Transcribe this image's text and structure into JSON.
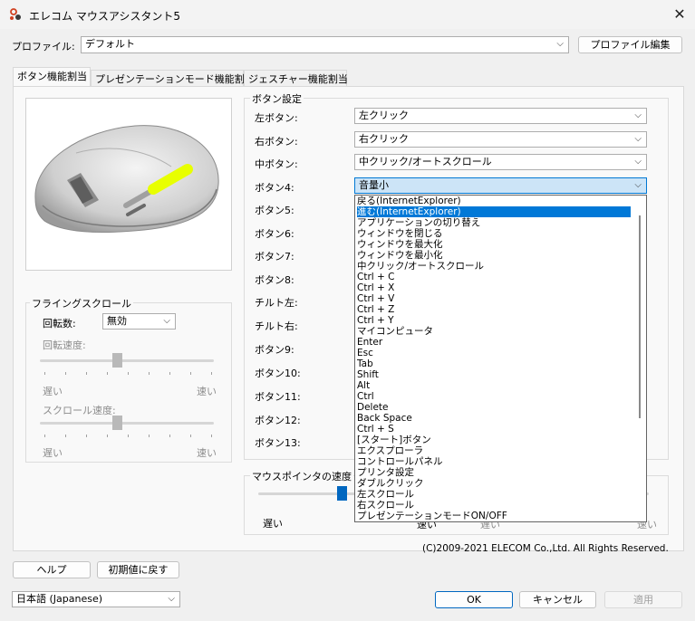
{
  "window": {
    "title": "エレコム マウスアシスタント5",
    "close_glyph": "✕"
  },
  "profile": {
    "label": "プロファイル:",
    "value": "デフォルト",
    "edit_button": "プロファイル編集"
  },
  "tabs": [
    {
      "label": "ボタン機能割当",
      "active": true
    },
    {
      "label": "プレゼンテーションモード機能割当",
      "active": false
    },
    {
      "label": "ジェスチャー機能割当",
      "active": false
    }
  ],
  "button_settings": {
    "title": "ボタン設定",
    "rows": [
      {
        "label": "左ボタン:",
        "value": "左クリック"
      },
      {
        "label": "右ボタン:",
        "value": "右クリック"
      },
      {
        "label": "中ボタン:",
        "value": "中クリック/オートスクロール"
      },
      {
        "label": "ボタン4:",
        "value": "音量小"
      },
      {
        "label": "ボタン5:"
      },
      {
        "label": "ボタン6:"
      },
      {
        "label": "ボタン7:"
      },
      {
        "label": "ボタン8:"
      },
      {
        "label": "チルト左:"
      },
      {
        "label": "チルト右:"
      },
      {
        "label": "ボタン9:"
      },
      {
        "label": "ボタン10:"
      },
      {
        "label": "ボタン11:"
      },
      {
        "label": "ボタン12:"
      },
      {
        "label": "ボタン13:"
      }
    ]
  },
  "dropdown_options": [
    "戻る(InternetExplorer)",
    "進む(InternetExplorer)",
    "アプリケーションの切り替え",
    "ウィンドウを閉じる",
    "ウィンドウを最大化",
    "ウィンドウを最小化",
    "中クリック/オートスクロール",
    "Ctrl + C",
    "Ctrl + X",
    "Ctrl + V",
    "Ctrl + Z",
    "Ctrl + Y",
    "マイコンピュータ",
    "Enter",
    "Esc",
    "Tab",
    "Shift",
    "Alt",
    "Ctrl",
    "Delete",
    "Back Space",
    "Ctrl + S",
    "[スタート]ボタン",
    "エクスプローラ",
    "コントロールパネル",
    "プリンタ設定",
    "ダブルクリック",
    "左スクロール",
    "右スクロール",
    "プレゼンテーションモードON/OFF"
  ],
  "dropdown_highlighted_index": 1,
  "flying_scroll": {
    "title": "フライングスクロール",
    "rotation_label": "回転数:",
    "rotation_value": "無効",
    "rotation_speed_label": "回転速度:",
    "scroll_speed_label": "スクロール速度:",
    "slow": "遅い",
    "fast": "速い"
  },
  "pointer_speed": {
    "title": "マウスポインタの速度",
    "slow": "遅い",
    "fast_partial": "速い",
    "right_slow": "遅い",
    "right_fast": "速い"
  },
  "copyright": "(C)2009-2021 ELECOM Co.,Ltd. All Rights Reserved.",
  "footer": {
    "help": "ヘルプ",
    "reset": "初期値に戻す",
    "language": "日本語 (Japanese)",
    "ok": "OK",
    "cancel": "キャンセル",
    "apply": "適用"
  },
  "colors": {
    "accent": "#0078d7",
    "highlight": "#e8ff00"
  }
}
